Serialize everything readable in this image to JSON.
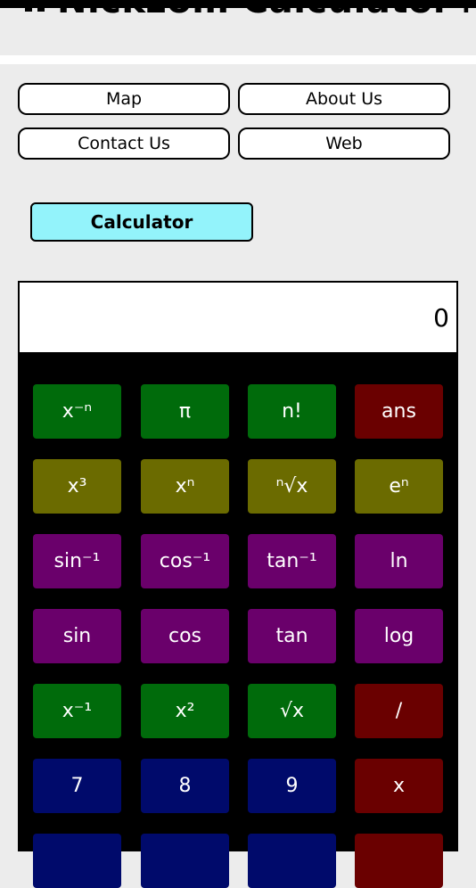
{
  "header": {
    "title": "Nickzom Calculator+"
  },
  "nav": {
    "map": "Map",
    "about": "About Us",
    "contact": "Contact Us",
    "web": "Web"
  },
  "calculator_tab": "Calculator",
  "display": {
    "value": "0"
  },
  "keys": [
    {
      "label": "x⁻ⁿ",
      "color": "green"
    },
    {
      "label": "π",
      "color": "green"
    },
    {
      "label": "n!",
      "color": "green"
    },
    {
      "label": "ans",
      "color": "red"
    },
    {
      "label": "x³",
      "color": "olive"
    },
    {
      "label": "xⁿ",
      "color": "olive"
    },
    {
      "label": "ⁿ√x",
      "color": "olive"
    },
    {
      "label": "eⁿ",
      "color": "olive"
    },
    {
      "label": "sin⁻¹",
      "color": "purple"
    },
    {
      "label": "cos⁻¹",
      "color": "purple"
    },
    {
      "label": "tan⁻¹",
      "color": "purple"
    },
    {
      "label": "ln",
      "color": "purple"
    },
    {
      "label": "sin",
      "color": "purple"
    },
    {
      "label": "cos",
      "color": "purple"
    },
    {
      "label": "tan",
      "color": "purple"
    },
    {
      "label": "log",
      "color": "purple"
    },
    {
      "label": "x⁻¹",
      "color": "green"
    },
    {
      "label": "x²",
      "color": "green"
    },
    {
      "label": "√x",
      "color": "green"
    },
    {
      "label": "/",
      "color": "red"
    },
    {
      "label": "7",
      "color": "blue"
    },
    {
      "label": "8",
      "color": "blue"
    },
    {
      "label": "9",
      "color": "blue"
    },
    {
      "label": "x",
      "color": "red"
    }
  ],
  "colors": {
    "green": "#006b0b",
    "red": "#6a0000",
    "olive": "#6b6b00",
    "purple": "#6a006b",
    "blue": "#000a6b",
    "tab": "#93f3fb"
  }
}
